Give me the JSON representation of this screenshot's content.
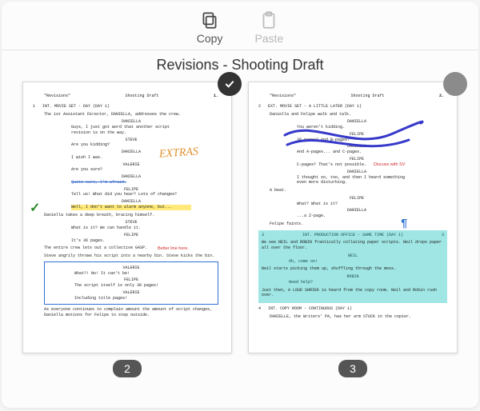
{
  "toolbar": {
    "copy": "Copy",
    "paste": "Paste"
  },
  "title": "Revisions - Shooting Draft",
  "pages": {
    "p2": {
      "number": "2",
      "header_title": "\"Revisions\"",
      "header_draft": "Shooting Draft",
      "header_page": "1.",
      "selected": true,
      "scenes": {
        "s1": {
          "num": "1",
          "heading": "INT. MOVIE SET - DAY (DAY 1)"
        }
      },
      "actions": {
        "a1": "The 1st Assistant Director, DANIELLA, addresses the crew.",
        "a2": "Daniella takes a deep breath, bracing himself.",
        "a3": "The entire crew lets out a collective GASP.",
        "a4": "Steve angrily throws his script into a nearby bin. Steve kicks the bin.",
        "a5": "As everyone continues to complain amount the amount of script changes, Daniella motions for Felipe to step outside."
      },
      "dialog": {
        "d_daniella": "DANIELLA",
        "d_steve": "STEVE",
        "d_valerie": "VALERIE",
        "d_felipe": "FELIPE",
        "l1": "Guys, I just got word that another script revision is on the way.",
        "l2": "Are you kidding?",
        "l3": "I wish I was.",
        "l4": "Are you sure?",
        "l5": "Quite sure, I'm afraid.",
        "l6": "Tell us! What did you hear? Lots of changes?",
        "l7": "Well, I don't want to alarm anyone, but...",
        "l8": "What is it? We can handle it.",
        "l9": "It's 36 pages.",
        "l10": "What?! No! It can't be!",
        "l11": "The script itself is only 30 pages!",
        "l12": "Including title pages!"
      },
      "annotations": {
        "extras": "EXTRAS",
        "better_line": "Better line here."
      }
    },
    "p3": {
      "number": "3",
      "header_title": "\"Revisions\"",
      "header_draft": "Shooting Draft",
      "header_page": "2.",
      "selected": false,
      "scenes": {
        "s2": {
          "num": "2",
          "heading": "EXT. MOVIE SET - A LITTLE LATER (DAY 1)"
        },
        "s3": {
          "num": "3",
          "heading": "INT. PRODUCTION OFFICE - SAME TIME (DAY 1)"
        },
        "s4": {
          "num": "4",
          "heading": "INT. COPY ROOM - CONTINUOUS (DAY 1)"
        }
      },
      "actions": {
        "a1": "Daniella and Felipe walk and talk.",
        "a2": "A beat.",
        "a3": "Felipe faints.",
        "a4": "We see NEIL and ROBIN frantically collating paper scripts. Neil drops paper all over the floor.",
        "a5": "Neil starts picking them up, shuffling through the mess.",
        "a6": "Just then, A LOUD SHRIEK is heard from the copy room. Neil and Robin rush over.",
        "a7": "DANIELLE, the Writers' PA, has her arm STUCK in the copier."
      },
      "dialog": {
        "d_daniella": "DANIELLA",
        "d_felipe": "FELIPE",
        "d_neil": "NEIL",
        "d_robin": "ROBIN",
        "l1": "You weren't kidding.",
        "l2": "And A-pages... and C-pages.",
        "l3": "C-pages? That's not possible.",
        "l4": "I thought so, too, and then I heard something even more disturbing.",
        "l5": "What? What is it?",
        "l6": "...a Z-page.",
        "l7": "Oh, come on!",
        "l8": "Need help?"
      },
      "annotations": {
        "discuss": "Discuss with SV"
      }
    }
  }
}
